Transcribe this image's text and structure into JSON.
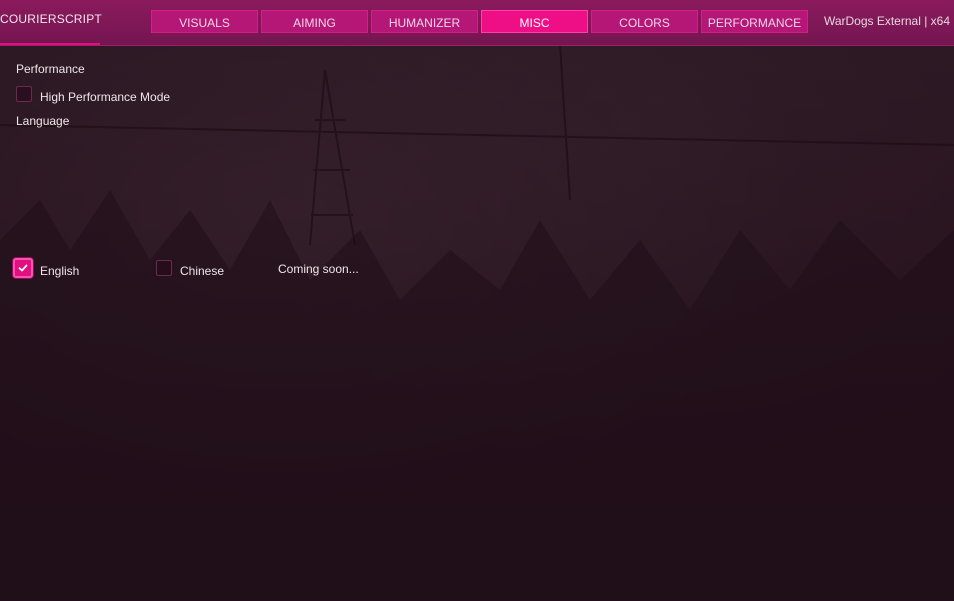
{
  "brand": "COURIERSCRIPT",
  "window_title": "WarDogs External | x64",
  "tabs": [
    {
      "label": "VISUALS",
      "active": false
    },
    {
      "label": "AIMING",
      "active": false
    },
    {
      "label": "HUMANIZER",
      "active": false
    },
    {
      "label": "MISC",
      "active": true
    },
    {
      "label": "COLORS",
      "active": false
    },
    {
      "label": "PERFORMANCE",
      "active": false
    }
  ],
  "performance": {
    "section_label": "Performance",
    "high_performance_mode": {
      "label": "High Performance Mode",
      "checked": false
    }
  },
  "language": {
    "section_label": "Language",
    "options": [
      {
        "label": "English",
        "checked": true
      },
      {
        "label": "Chinese",
        "checked": false
      }
    ],
    "coming_soon": "Coming soon..."
  },
  "colors": {
    "accent": "#e0107f",
    "header": "#7d1855",
    "tab": "#b51777",
    "tab_active": "#ee0e86",
    "background": "#2a1b22"
  },
  "icons": {
    "checkmark": "checkmark-icon"
  }
}
